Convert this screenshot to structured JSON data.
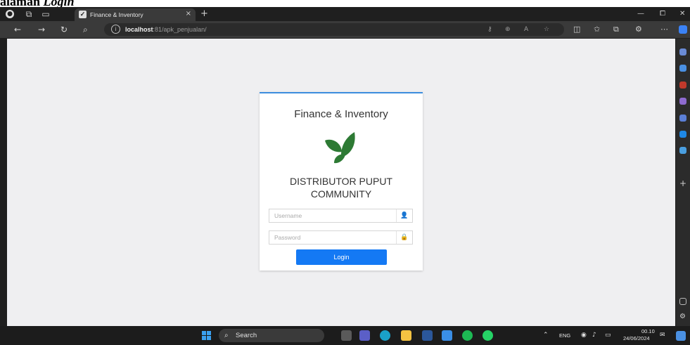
{
  "document": {
    "heading_prefix": "alaman ",
    "heading_italic": "Login"
  },
  "browser": {
    "tab_title": "Finance & Inventory",
    "tab_close": "×",
    "new_tab": "+",
    "url_host": "localhost",
    "url_path": ":81/apk_penjualan/"
  },
  "page": {
    "title": "Finance & Inventory",
    "company_line1": "DISTRIBUTOR PUPUT",
    "company_line2": "COMMUNITY",
    "username_placeholder": "Username",
    "password_placeholder": "Password",
    "login_label": "Login",
    "brand_color": "#2d7a34",
    "accent_color": "#3c8dde",
    "button_color": "#1479f4"
  },
  "taskbar": {
    "search_label": "Search",
    "language": "ENG",
    "time": "00.10",
    "date": "24/06/2024"
  }
}
